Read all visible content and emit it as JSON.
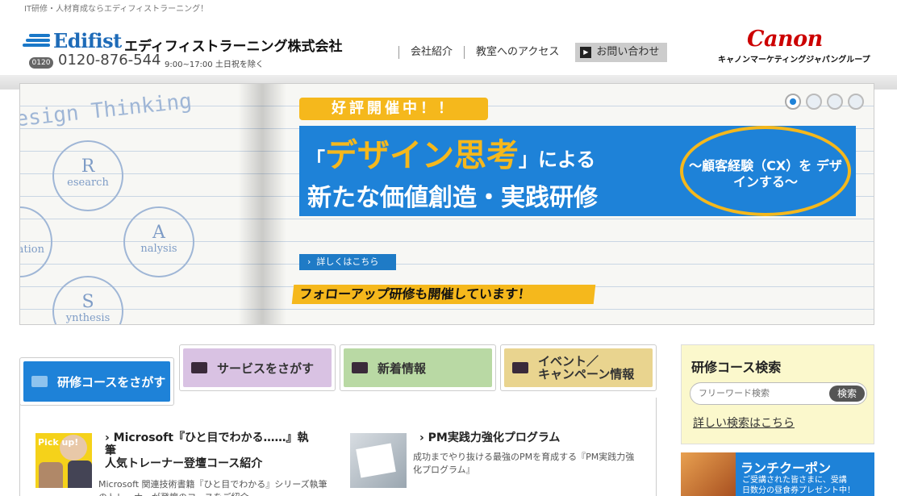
{
  "header": {
    "tagline": "IT研修・人材育成ならエディフィストラーニング！",
    "logo_en": "Edifist",
    "logo_jp": "エディフィストラーニング株式会社",
    "phone_icon": "free-dial-icon",
    "phone_icon_text": "0120",
    "phone": "0120-876-544",
    "hours": "9:00~17:00 土日祝を除く",
    "nav": [
      "会社紹介",
      "教室へのアクセス"
    ],
    "contact_label": "お問い合わせ",
    "canon_brand": "Canon",
    "canon_sub": "キャノンマーケティングジャパングループ"
  },
  "hero": {
    "sketch_title": "esign Thinking",
    "circles": [
      {
        "big": "R",
        "small": "esearch"
      },
      {
        "big": "A",
        "small": "nalysis"
      },
      {
        "big": "S",
        "small": "ynthesis"
      },
      {
        "big": "",
        "small": "ation"
      }
    ],
    "badge": "好評開催中！！",
    "headline_open": "「",
    "headline_highlight": "デザイン思考",
    "headline_close": "」による",
    "headline_line2": "新たな価値創造・実践研修",
    "oval_text": "～顧客経験（CX）を デザインする～",
    "more_label": "詳しくはこちら",
    "followup": "フォローアップ研修も開催しています！",
    "slides": 4,
    "active_slide": 1
  },
  "tabs": [
    {
      "label": "研修コースをさがす"
    },
    {
      "label": "サービスをさがす"
    },
    {
      "label": "新着情報"
    },
    {
      "label_line1": "イベント／",
      "label_line2": "キャンペーン情報"
    }
  ],
  "news": [
    {
      "thumb_text": "Pick up!",
      "title_line1": "Microsoft『ひと目でわかる……』執",
      "title_line2": "筆",
      "title_line3": "人気トレーナー登壇コース紹介",
      "desc": "Microsoft 関連技術書籍『ひと目でわかる』シリーズ執筆のトレーナーが登壇のコースをご紹介"
    },
    {
      "title": "PM実践力強化プログラム",
      "desc": "成功までやり抜ける最強のPMを育成する『PM実践力強化プログラム』"
    }
  ],
  "search": {
    "title": "研修コース検索",
    "placeholder": "フリーワード検索",
    "button": "検索",
    "advanced": "詳しい検索はこちら"
  },
  "lunch": {
    "title": "ランチクーポン",
    "desc_line1": "ご受講された皆さまに、受講",
    "desc_line2": "日数分の昼食券プレゼント中！"
  }
}
